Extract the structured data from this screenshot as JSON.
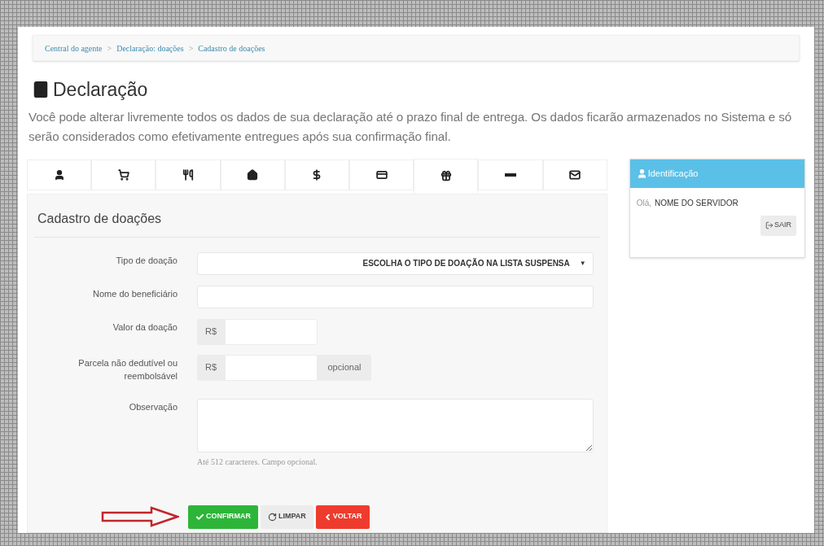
{
  "breadcrumb": [
    {
      "label": "Central do agente"
    },
    {
      "separator": ">",
      "label": "Declaração: doações"
    },
    {
      "separator": ">",
      "label": "Cadastro de doações"
    }
  ],
  "page": {
    "title": "Declaração",
    "description": "Você pode alterar livremente todos os dados de sua declaração até o prazo final de entrega. Os dados ficarão armazenados no Sistema e só serão considerados como efetivamente entregues após sua confirmação final."
  },
  "tabs": [
    {
      "kind": "person",
      "selected": false
    },
    {
      "kind": "shopping",
      "selected": false
    },
    {
      "kind": "food",
      "selected": false
    },
    {
      "kind": "housing",
      "selected": false
    },
    {
      "kind": "money",
      "selected": false
    },
    {
      "kind": "payment",
      "selected": false
    },
    {
      "kind": "donation",
      "selected": true
    },
    {
      "kind": "other",
      "selected": false
    },
    {
      "kind": "message",
      "selected": false
    }
  ],
  "form": {
    "title": "Cadastro de doações",
    "fields": [
      {
        "kind": "select",
        "label": "Tipo de doação",
        "value": "ESCOLHA O TIPO DE DOAÇÃO NA LISTA SUSPENSA",
        "caret": "▼"
      },
      {
        "kind": "text",
        "label": "Nome do beneficiário"
      },
      {
        "kind": "currency",
        "label": "Valor da doação",
        "prefix": "R$"
      },
      {
        "kind": "currency",
        "label": "Parcela não dedutível ou reembolsável",
        "prefix": "R$",
        "suffix": "opcional"
      },
      {
        "kind": "textarea",
        "label": "Observação",
        "help": "Até 512 caracteres. Campo opcional."
      }
    ],
    "buttons": [
      {
        "kind": "confirm",
        "label": "CONFIRMAR"
      },
      {
        "kind": "clear",
        "label": "LIMPAR"
      },
      {
        "kind": "back",
        "label": "VOLTAR"
      }
    ]
  },
  "identification": {
    "title": "Identificação",
    "greeting": "Olá,",
    "name": "NOME DO SERVIDOR",
    "logout": "SAIR"
  }
}
